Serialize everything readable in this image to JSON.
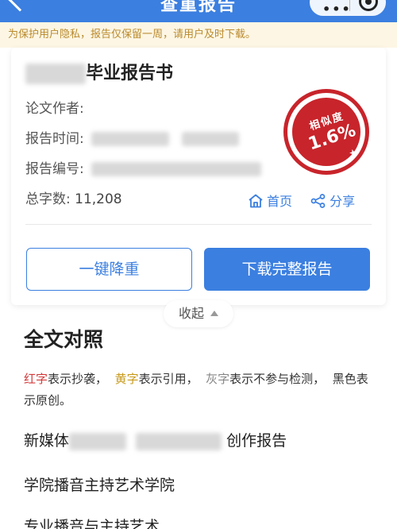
{
  "header": {
    "title": "查重报告",
    "menu_dots": "•••"
  },
  "notice": "为保护用户隐私，报告仅保留一周，请用户及时下载。",
  "report": {
    "title_suffix": "毕业报告书",
    "author_label": "论文作者:",
    "time_label": "报告时间:",
    "id_label": "报告编号:",
    "word_count_label": "总字数:",
    "word_count_value": "11,208"
  },
  "stamp": {
    "label": "相似度",
    "value": "1.6%"
  },
  "links": {
    "home": "首页",
    "share": "分享"
  },
  "buttons": {
    "reduce": "一键降重",
    "download": "下载完整报告"
  },
  "collapse_label": "收起",
  "section": {
    "title": "全文对照",
    "legend": {
      "red_word": "红字",
      "red_desc": "表示抄袭，",
      "yellow_word": "黄字",
      "yellow_desc": "表示引用，",
      "gray_word": "灰字",
      "gray_desc": "表示不参与检测，",
      "black_desc": "黑色表示原创。"
    }
  },
  "content": {
    "line1_prefix": "新媒体",
    "line1_suffix": "创作报告",
    "line2": "学院播音主持艺术学院",
    "line3": "专业播音与主持艺术"
  }
}
